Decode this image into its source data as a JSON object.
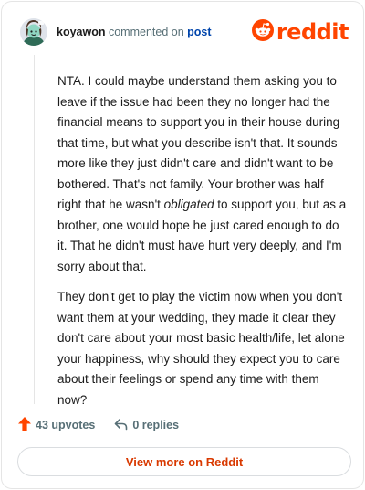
{
  "header": {
    "username": "koyawon",
    "action_text": "commented on",
    "post_link": "post",
    "brand": "reddit"
  },
  "comment": {
    "paragraph1_before_em": "NTA. I could maybe understand them asking you to leave if the issue had been they no longer had the financial means to support you in their house during that time, but what you describe isn't that. It sounds more like they just didn't care and didn't want to be bothered. That's not family. Your brother was half right that he wasn't ",
    "paragraph1_em": "obligated",
    "paragraph1_after_em": " to support you, but as a brother, one would hope he just cared enough to do it. That he didn't must have hurt very deeply, and I'm sorry about that.",
    "paragraph2": "They don't get to play the victim now when you don't want them at your wedding, they made it clear they don't care about your most basic health/life, let alone your happiness, why should they expect you to care about their feelings or spend any time with them now?"
  },
  "actions": {
    "upvotes": "43 upvotes",
    "replies": "0 replies"
  },
  "footer": {
    "view_more_label": "View more on Reddit"
  },
  "colors": {
    "brand": "#ff4500",
    "upvote": "#ff4500",
    "link": "#0045ac",
    "view_more": "#d93900",
    "muted": "#576f76"
  },
  "icons": {
    "avatar": "snoo-avatar",
    "logo": "reddit-snoo-icon",
    "upvote": "upvote-arrow-icon",
    "reply": "reply-arrow-icon"
  }
}
